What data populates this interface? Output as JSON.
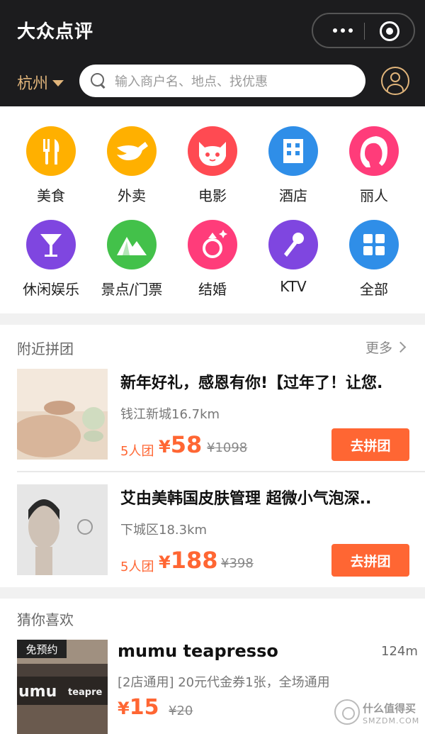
{
  "header": {
    "title": "大众点评",
    "city": "杭州",
    "search_placeholder": "输入商户名、地点、找优惠"
  },
  "categories": [
    {
      "label": "美食",
      "icon": "fork-knife-icon",
      "color": "#ffb000"
    },
    {
      "label": "外卖",
      "icon": "kangaroo-icon",
      "color": "#ffb000"
    },
    {
      "label": "电影",
      "icon": "cat-icon",
      "color": "#ff4a52"
    },
    {
      "label": "酒店",
      "icon": "building-icon",
      "color": "#2f8ee8"
    },
    {
      "label": "丽人",
      "icon": "woman-face-icon",
      "color": "#ff3c7a"
    },
    {
      "label": "休闲娱乐",
      "icon": "cocktail-icon",
      "color": "#7f46e0"
    },
    {
      "label": "景点/门票",
      "icon": "mountain-icon",
      "color": "#43c14a"
    },
    {
      "label": "结婚",
      "icon": "ring-icon",
      "color": "#ff3c7a"
    },
    {
      "label": "KTV",
      "icon": "microphone-icon",
      "color": "#7f46e0"
    },
    {
      "label": "全部",
      "icon": "grid-icon",
      "color": "#2f8ee8"
    }
  ],
  "nearby": {
    "title": "附近拼团",
    "more": "更多",
    "deals": [
      {
        "name": "新年好礼，感恩有你!【过年了！让您.",
        "location": "钱江新城16.7km",
        "group": "5人团",
        "currency": "¥",
        "price": "58",
        "old_price": "¥1098",
        "button": "去拼团"
      },
      {
        "name": "艾由美韩国皮肤管理 超微小气泡深..",
        "location": "下城区18.3km",
        "group": "5人团",
        "currency": "¥",
        "price": "188",
        "old_price": "¥398",
        "button": "去拼团"
      }
    ]
  },
  "recommend": {
    "title": "猜你喜欢",
    "items": [
      {
        "badge": "免预约",
        "name": "mumu teapresso",
        "distance": "124m",
        "desc": "[2店通用] 20元代金券1张，全场通用",
        "currency": "¥",
        "price": "15",
        "old_price": "¥20"
      }
    ]
  },
  "watermark": {
    "line1": "什么值得买",
    "line2": "SMZDM.COM"
  }
}
